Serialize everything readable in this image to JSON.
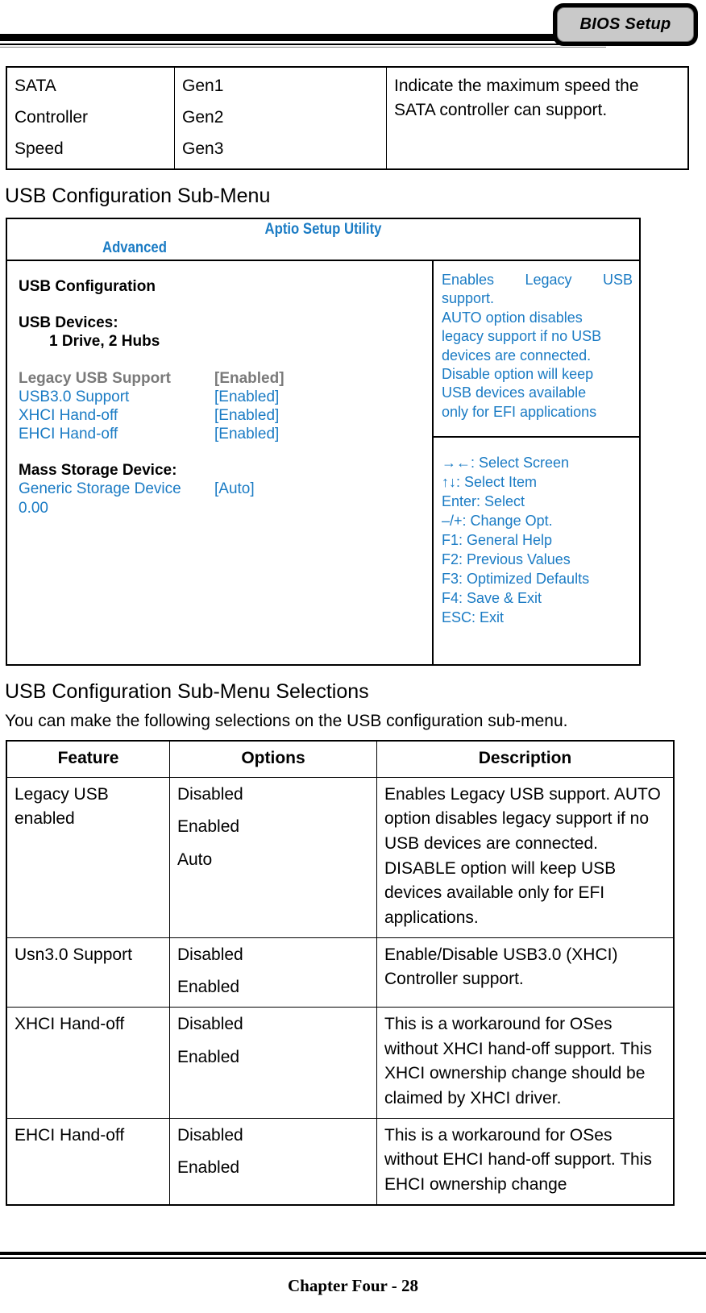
{
  "header": {
    "tab_label": "BIOS Setup"
  },
  "sata_table": {
    "feature": [
      "SATA",
      "Controller",
      "Speed"
    ],
    "options": [
      "Gen1",
      "Gen2",
      "Gen3"
    ],
    "description": "Indicate the maximum speed the SATA controller can support."
  },
  "headings": {
    "usb_config": "USB Configuration Sub-Menu",
    "usb_selections": "USB Configuration Sub-Menu Selections",
    "usb_selections_intro": "You can make the following selections on the USB configuration sub-menu."
  },
  "bios_screen": {
    "title": "Aptio Setup Utility",
    "menu_tab": "Advanced",
    "accent_color": "#1a7bc4",
    "selected_color": "#7a7a7a",
    "section_title": "USB Configuration",
    "devices_label": "USB Devices:",
    "devices_value": "1 Drive, 2 Hubs",
    "settings": [
      {
        "label": "Legacy USB Support",
        "value": "[Enabled]",
        "selected": true
      },
      {
        "label": "USB3.0 Support",
        "value": "[Enabled]",
        "selected": false
      },
      {
        "label": "XHCI Hand-off",
        "value": "[Enabled]",
        "selected": false
      },
      {
        "label": "EHCI Hand-off",
        "value": "[Enabled]",
        "selected": false
      }
    ],
    "mass_storage_label": "Mass Storage Device:",
    "mass_storage_device": "Generic Storage Device 0.00",
    "mass_storage_value": "[Auto]",
    "help_lines": [
      "Enables Legacy USB support.",
      "AUTO option disables",
      "legacy support if no USB",
      "devices are connected.",
      "Disable option will keep",
      "USB devices available",
      "only for EFI applications"
    ],
    "key_help": [
      "→←: Select Screen",
      "↑↓: Select Item",
      "Enter: Select",
      "–/+: Change Opt.",
      "F1: General Help",
      "F2: Previous Values",
      "F3: Optimized Defaults",
      "F4: Save & Exit",
      "ESC: Exit"
    ]
  },
  "selections_table": {
    "headers": [
      "Feature",
      "Options",
      "Description"
    ],
    "rows": [
      {
        "feature": "Legacy USB enabled",
        "options": [
          "Disabled",
          "Enabled",
          "Auto"
        ],
        "description": "Enables Legacy USB support. AUTO option disables legacy support if no USB devices are connected. DISABLE option will keep USB devices available only for EFI applications."
      },
      {
        "feature": "Usn3.0 Support",
        "options": [
          "Disabled",
          "Enabled"
        ],
        "description": "Enable/Disable USB3.0 (XHCI) Controller support."
      },
      {
        "feature": "XHCI Hand-off",
        "options": [
          "Disabled",
          "Enabled"
        ],
        "description": "This is a workaround for OSes without XHCI hand-off support. This XHCI ownership change should be claimed by XHCI driver."
      },
      {
        "feature": "EHCI Hand-off",
        "options": [
          "Disabled",
          "Enabled"
        ],
        "description": "This is a workaround for OSes without EHCI hand-off support. This EHCI ownership change"
      }
    ]
  },
  "footer": {
    "text": "Chapter Four - 28"
  }
}
